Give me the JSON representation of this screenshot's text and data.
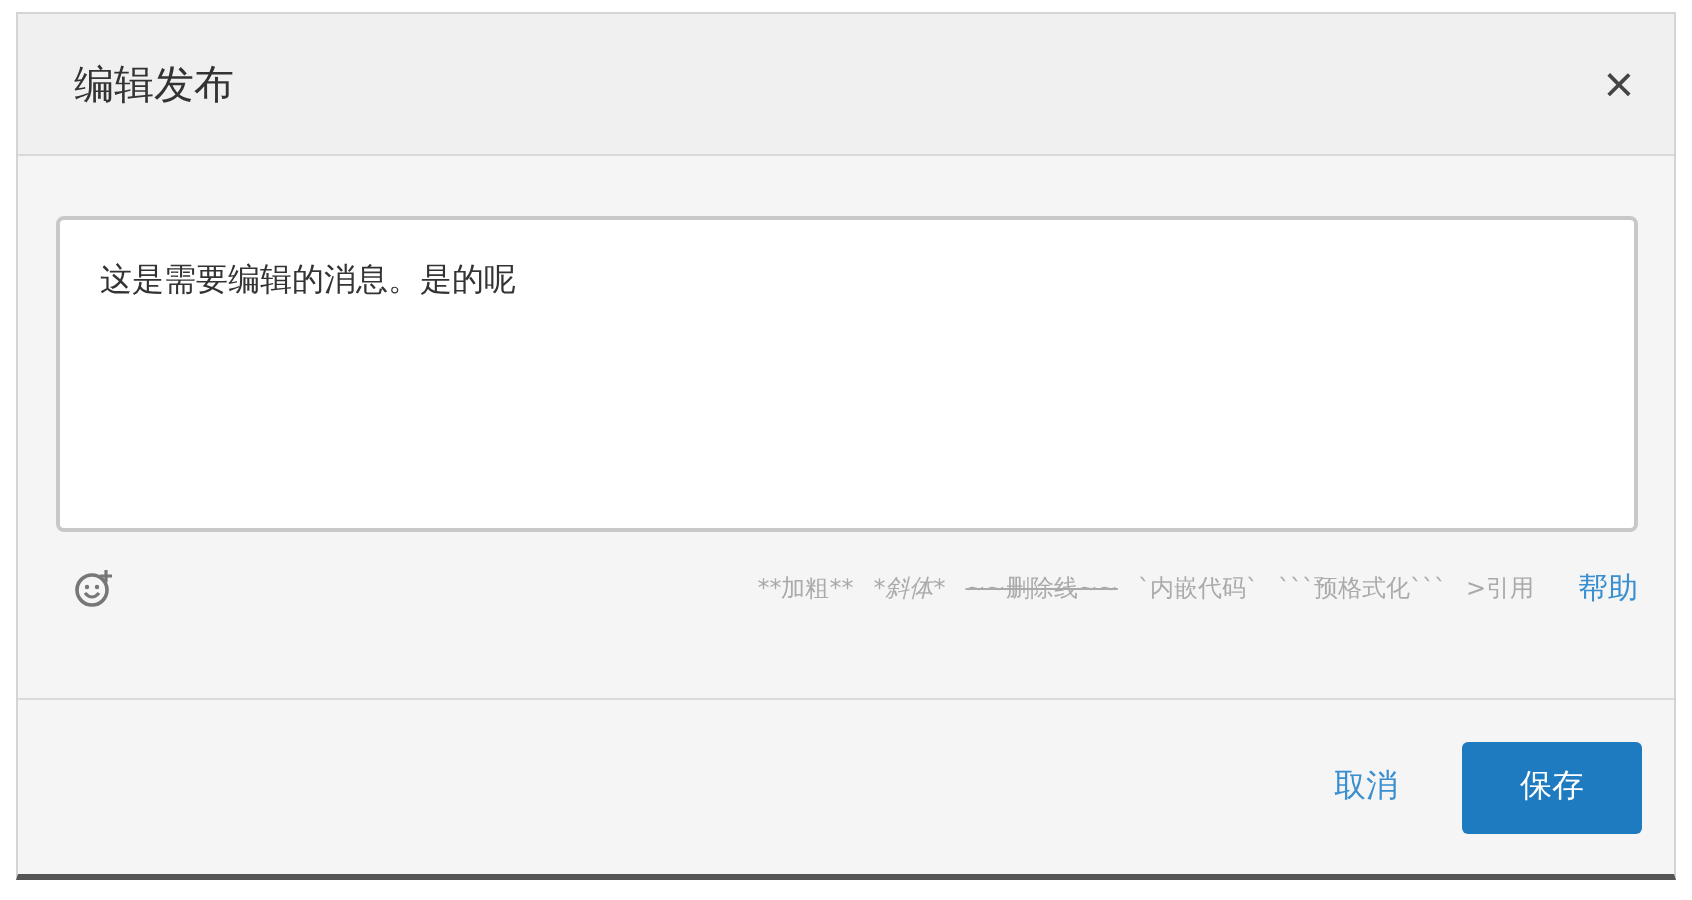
{
  "dialog": {
    "title": "编辑发布",
    "close": "×"
  },
  "editor": {
    "value": "这是需要编辑的消息。是的呢"
  },
  "hints": [
    {
      "text": "**加粗**",
      "kind": "plain"
    },
    {
      "text": "*斜体*",
      "kind": "italic"
    },
    {
      "text": "~~删除线~~",
      "kind": "strike"
    },
    {
      "text": "`内嵌代码`",
      "kind": "plain"
    },
    {
      "text": "```预格式化```",
      "kind": "plain"
    },
    {
      "text": ">引用",
      "kind": "plain"
    }
  ],
  "help": "帮助",
  "buttons": {
    "cancel": "取消",
    "save": "保存"
  }
}
